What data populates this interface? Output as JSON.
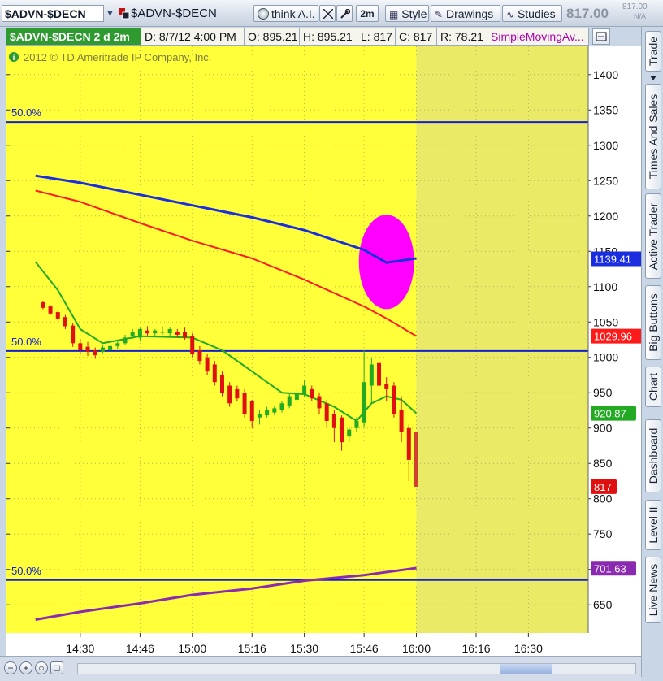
{
  "toolbar": {
    "symbol": "$ADVN-$DECN",
    "compare_symbol": "$ADVN-$DECN",
    "think_ai_label": "think A.I.",
    "aggregation_label": "2m",
    "style_label": "Style",
    "drawings_label": "Drawings",
    "studies_label": "Studies",
    "last_price": "817.00",
    "last_price_small": "817.00",
    "na_label": "N/A"
  },
  "infobar": {
    "symbol_period": "$ADVN-$DECN 2 d 2m",
    "date": "D: 8/7/12 4:00 PM",
    "open": "O: 895.21",
    "high": "H: 895.21",
    "low": "L: 817",
    "close": "C: 817",
    "range": "R: 78.21",
    "study": "SimpleMovingAv..."
  },
  "copyright": "2012 © TD Ameritrade IP Company, Inc.",
  "side_tabs": [
    "Trade",
    "Times And Sales",
    "Active Trader",
    "Big Buttons",
    "Chart",
    "Dashboard",
    "Level II",
    "Live News"
  ],
  "colors": {
    "session_bg": "#ffff3a",
    "afterhours_bg": "#eaea66",
    "up_candle": "#22aa22",
    "down_candle": "#e01010",
    "blue_ma": "#1a2ee0",
    "red_ma": "#ff1a1a",
    "green_ma": "#22aa22",
    "purple_ma": "#8a2ab0",
    "fib_line": "#1420d0",
    "highlight": "#ff00ff"
  },
  "chart_data": {
    "type": "candlestick",
    "xlabel": "",
    "ylabel": "",
    "x_ticks": [
      "14:30",
      "14:46",
      "15:00",
      "15:16",
      "15:30",
      "15:46",
      "16:00",
      "16:16",
      "16:30"
    ],
    "y_ticks": [
      1400,
      1350,
      1300,
      1250,
      1200,
      1150,
      1100,
      1050,
      1000,
      950,
      900,
      850,
      800,
      750,
      700,
      650
    ],
    "ylim": [
      610,
      1440
    ],
    "xlim_minutes": [
      14.167,
      16.767
    ],
    "session_end": "16:00",
    "fib_levels": [
      {
        "label": "50.0%",
        "value": 1333
      },
      {
        "label": "50.0%",
        "value": 1009
      },
      {
        "label": "50.0%",
        "value": 685
      }
    ],
    "price_labels": [
      {
        "value": 1139.41,
        "text": "1139.41",
        "color": "#1a2ee0"
      },
      {
        "value": 1029.96,
        "text": "1029.96",
        "color": "#ff1a1a"
      },
      {
        "value": 920.87,
        "text": "920.87",
        "color": "#22aa22"
      },
      {
        "value": 817,
        "text": "817",
        "color": "#e01010"
      },
      {
        "value": 701.63,
        "text": "701.63",
        "color": "#8a2ab0"
      }
    ],
    "highlight_ellipse": {
      "center_time": "15:52",
      "center_value": 1135,
      "note": "magenta marker"
    },
    "candles": [
      {
        "t": "14:20",
        "o": 1078,
        "h": 1080,
        "l": 1068,
        "c": 1070
      },
      {
        "t": "14:22",
        "o": 1072,
        "h": 1074,
        "l": 1060,
        "c": 1062
      },
      {
        "t": "14:24",
        "o": 1064,
        "h": 1066,
        "l": 1052,
        "c": 1055
      },
      {
        "t": "14:26",
        "o": 1057,
        "h": 1060,
        "l": 1040,
        "c": 1044
      },
      {
        "t": "14:28",
        "o": 1045,
        "h": 1048,
        "l": 1015,
        "c": 1020
      },
      {
        "t": "14:30",
        "o": 1020,
        "h": 1026,
        "l": 1005,
        "c": 1010
      },
      {
        "t": "14:32",
        "o": 1015,
        "h": 1022,
        "l": 1002,
        "c": 1008
      },
      {
        "t": "14:34",
        "o": 1010,
        "h": 1014,
        "l": 998,
        "c": 1003
      },
      {
        "t": "14:36",
        "o": 1008,
        "h": 1018,
        "l": 1006,
        "c": 1014
      },
      {
        "t": "14:38",
        "o": 1010,
        "h": 1020,
        "l": 1008,
        "c": 1016
      },
      {
        "t": "14:40",
        "o": 1016,
        "h": 1025,
        "l": 1012,
        "c": 1020
      },
      {
        "t": "14:42",
        "o": 1020,
        "h": 1032,
        "l": 1018,
        "c": 1028
      },
      {
        "t": "14:44",
        "o": 1030,
        "h": 1040,
        "l": 1026,
        "c": 1036
      },
      {
        "t": "14:46",
        "o": 1028,
        "h": 1042,
        "l": 1024,
        "c": 1040
      },
      {
        "t": "14:48",
        "o": 1038,
        "h": 1044,
        "l": 1030,
        "c": 1034
      },
      {
        "t": "14:50",
        "o": 1034,
        "h": 1040,
        "l": 1030,
        "c": 1038
      },
      {
        "t": "14:52",
        "o": 1036,
        "h": 1044,
        "l": 1032,
        "c": 1036
      },
      {
        "t": "14:54",
        "o": 1034,
        "h": 1042,
        "l": 1030,
        "c": 1040
      },
      {
        "t": "14:56",
        "o": 1036,
        "h": 1040,
        "l": 1028,
        "c": 1032
      },
      {
        "t": "14:58",
        "o": 1036,
        "h": 1042,
        "l": 1025,
        "c": 1028
      },
      {
        "t": "15:00",
        "o": 1030,
        "h": 1034,
        "l": 1000,
        "c": 1005
      },
      {
        "t": "15:02",
        "o": 1010,
        "h": 1016,
        "l": 990,
        "c": 995
      },
      {
        "t": "15:04",
        "o": 1000,
        "h": 1005,
        "l": 975,
        "c": 980
      },
      {
        "t": "15:06",
        "o": 990,
        "h": 995,
        "l": 960,
        "c": 965
      },
      {
        "t": "15:08",
        "o": 975,
        "h": 980,
        "l": 945,
        "c": 950
      },
      {
        "t": "15:10",
        "o": 960,
        "h": 965,
        "l": 930,
        "c": 935
      },
      {
        "t": "15:12",
        "o": 955,
        "h": 960,
        "l": 938,
        "c": 942
      },
      {
        "t": "15:14",
        "o": 950,
        "h": 955,
        "l": 915,
        "c": 920
      },
      {
        "t": "15:16",
        "o": 938,
        "h": 940,
        "l": 900,
        "c": 910
      },
      {
        "t": "15:18",
        "o": 915,
        "h": 925,
        "l": 905,
        "c": 920
      },
      {
        "t": "15:20",
        "o": 918,
        "h": 930,
        "l": 915,
        "c": 925
      },
      {
        "t": "15:22",
        "o": 922,
        "h": 932,
        "l": 918,
        "c": 928
      },
      {
        "t": "15:24",
        "o": 926,
        "h": 938,
        "l": 922,
        "c": 935
      },
      {
        "t": "15:26",
        "o": 932,
        "h": 948,
        "l": 928,
        "c": 945
      },
      {
        "t": "15:28",
        "o": 940,
        "h": 955,
        "l": 936,
        "c": 950
      },
      {
        "t": "15:30",
        "o": 948,
        "h": 968,
        "l": 944,
        "c": 960
      },
      {
        "t": "15:32",
        "o": 955,
        "h": 960,
        "l": 938,
        "c": 942
      },
      {
        "t": "15:34",
        "o": 945,
        "h": 950,
        "l": 920,
        "c": 928
      },
      {
        "t": "15:36",
        "o": 935,
        "h": 940,
        "l": 900,
        "c": 910
      },
      {
        "t": "15:38",
        "o": 920,
        "h": 925,
        "l": 880,
        "c": 900
      },
      {
        "t": "15:40",
        "o": 915,
        "h": 918,
        "l": 868,
        "c": 880
      },
      {
        "t": "15:42",
        "o": 888,
        "h": 902,
        "l": 880,
        "c": 898
      },
      {
        "t": "15:44",
        "o": 900,
        "h": 915,
        "l": 895,
        "c": 910
      },
      {
        "t": "15:46",
        "o": 908,
        "h": 1010,
        "l": 902,
        "c": 965
      },
      {
        "t": "15:48",
        "o": 960,
        "h": 1000,
        "l": 935,
        "c": 990
      },
      {
        "t": "15:50",
        "o": 992,
        "h": 1005,
        "l": 955,
        "c": 960
      },
      {
        "t": "15:52",
        "o": 962,
        "h": 972,
        "l": 938,
        "c": 955
      },
      {
        "t": "15:54",
        "o": 960,
        "h": 965,
        "l": 915,
        "c": 920
      },
      {
        "t": "15:56",
        "o": 925,
        "h": 945,
        "l": 880,
        "c": 895
      },
      {
        "t": "15:58",
        "o": 900,
        "h": 905,
        "l": 825,
        "c": 855
      },
      {
        "t": "16:00",
        "o": 895,
        "h": 895,
        "l": 817,
        "c": 817
      }
    ],
    "series": [
      {
        "name": "Blue MA",
        "points": [
          [
            "14:18",
            1257
          ],
          [
            "14:30",
            1247
          ],
          [
            "14:46",
            1230
          ],
          [
            "15:00",
            1215
          ],
          [
            "15:16",
            1198
          ],
          [
            "15:30",
            1180
          ],
          [
            "15:46",
            1152
          ],
          [
            "15:52",
            1134
          ],
          [
            "16:00",
            1140
          ]
        ]
      },
      {
        "name": "Red MA",
        "points": [
          [
            "14:18",
            1236
          ],
          [
            "14:30",
            1220
          ],
          [
            "14:46",
            1190
          ],
          [
            "15:00",
            1165
          ],
          [
            "15:16",
            1140
          ],
          [
            "15:30",
            1110
          ],
          [
            "15:46",
            1072
          ],
          [
            "15:52",
            1055
          ],
          [
            "16:00",
            1030
          ]
        ]
      },
      {
        "name": "Green MA",
        "points": [
          [
            "14:18",
            1135
          ],
          [
            "14:24",
            1095
          ],
          [
            "14:30",
            1040
          ],
          [
            "14:36",
            1020
          ],
          [
            "14:46",
            1030
          ],
          [
            "15:00",
            1028
          ],
          [
            "15:08",
            1010
          ],
          [
            "15:16",
            980
          ],
          [
            "15:24",
            950
          ],
          [
            "15:30",
            948
          ],
          [
            "15:38",
            930
          ],
          [
            "15:44",
            910
          ],
          [
            "15:48",
            935
          ],
          [
            "15:52",
            945
          ],
          [
            "15:56",
            940
          ],
          [
            "16:00",
            921
          ]
        ]
      },
      {
        "name": "Purple MA",
        "points": [
          [
            "14:18",
            629
          ],
          [
            "14:30",
            640
          ],
          [
            "14:46",
            652
          ],
          [
            "15:00",
            664
          ],
          [
            "15:16",
            673
          ],
          [
            "15:30",
            684
          ],
          [
            "15:46",
            692
          ],
          [
            "16:00",
            702
          ]
        ]
      }
    ]
  }
}
